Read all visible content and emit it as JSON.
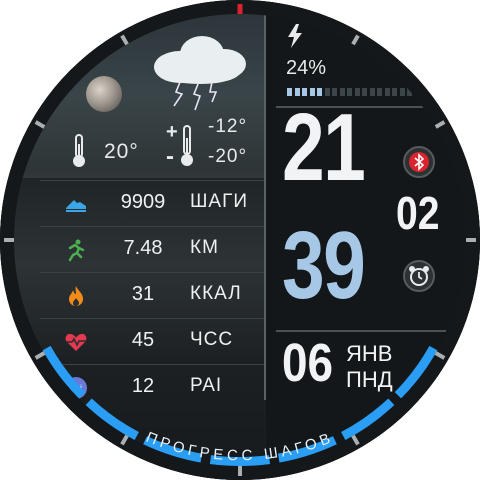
{
  "weather": {
    "condition_icon": "thunderstorm-cloud-icon",
    "moon_icon": "moon-phase-icon",
    "temp_current": "20°",
    "temp_max": "-12°",
    "temp_min": "-20°",
    "temp_max_prefix": "+",
    "temp_min_prefix": "-"
  },
  "stats": [
    {
      "icon": "shoe-icon",
      "value": "9909",
      "unit": "ШАГИ",
      "color": "#3aa6e8"
    },
    {
      "icon": "running-icon",
      "value": "7.48",
      "unit": "КМ",
      "color": "#4caf50"
    },
    {
      "icon": "flame-icon",
      "value": "31",
      "unit": "ККАЛ",
      "color": "#f08a1a"
    },
    {
      "icon": "heart-rate-icon",
      "value": "45",
      "unit": "ЧСС",
      "color": "#e53950"
    },
    {
      "icon": "pai-icon",
      "value": "12",
      "unit": "PAI",
      "color": "#6a78d8",
      "icon_text": "pai"
    }
  ],
  "battery": {
    "icon": "bolt-icon",
    "percent_label": "24%",
    "level": 0.24
  },
  "time": {
    "hour": "21",
    "minute": "39",
    "seconds": "02"
  },
  "status_icons": {
    "bluetooth": "bluetooth-icon",
    "alarm": "alarm-clock-icon"
  },
  "date": {
    "day": "06",
    "month": "ЯНВ",
    "weekday": "ПНД"
  },
  "progress": {
    "label": "ПРОГРЕСС ШАГОВ",
    "segments_total": 7,
    "segments_filled": 7,
    "color": "#2a9df4"
  },
  "colors": {
    "accent_blue": "#a6c8e6",
    "top_marker": "#d9232e"
  }
}
